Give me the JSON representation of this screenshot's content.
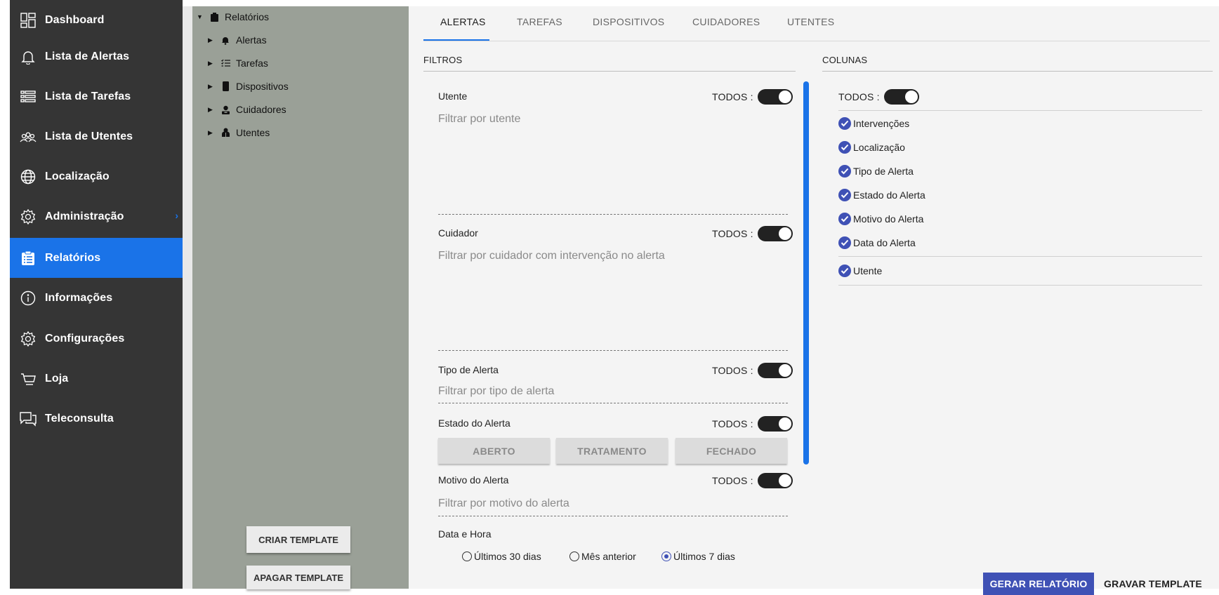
{
  "sidebar": {
    "items": [
      {
        "label": "Dashboard",
        "icon": "dashboard-icon"
      },
      {
        "label": "Lista de Alertas",
        "icon": "bell-icon"
      },
      {
        "label": "Lista de Tarefas",
        "icon": "list-icon"
      },
      {
        "label": "Lista de Utentes",
        "icon": "people-icon"
      },
      {
        "label": "Localização",
        "icon": "globe-icon"
      },
      {
        "label": "Administração",
        "icon": "gear-icon",
        "chevron": "›"
      },
      {
        "label": "Relatórios",
        "icon": "clipboard-icon",
        "active": true
      },
      {
        "label": "Informações",
        "icon": "info-icon"
      },
      {
        "label": "Configurações",
        "icon": "gear-icon"
      },
      {
        "label": "Loja",
        "icon": "cart-icon"
      },
      {
        "label": "Teleconsulta",
        "icon": "chat-icon"
      }
    ]
  },
  "tree": {
    "root": {
      "label": "Relatórios",
      "icon": "clipboard-icon"
    },
    "children": [
      {
        "label": "Alertas",
        "icon": "bell-icon"
      },
      {
        "label": "Tarefas",
        "icon": "checklist-icon"
      },
      {
        "label": "Dispositivos",
        "icon": "phone-icon"
      },
      {
        "label": "Cuidadores",
        "icon": "caregiver-icon"
      },
      {
        "label": "Utentes",
        "icon": "patient-icon"
      }
    ],
    "create_template": "CRIAR TEMPLATE",
    "delete_template": "APAGAR TEMPLATE"
  },
  "tabs": [
    "ALERTAS",
    "TAREFAS",
    "DISPOSITIVOS",
    "CUIDADORES",
    "UTENTES"
  ],
  "filters": {
    "title": "FILTROS",
    "todos_label": "TODOS :",
    "utente": {
      "label": "Utente",
      "placeholder": "Filtrar por utente"
    },
    "cuidador": {
      "label": "Cuidador",
      "placeholder": "Filtrar por cuidador com intervenção no alerta"
    },
    "tipo": {
      "label": "Tipo de Alerta",
      "placeholder": "Filtrar por tipo de alerta"
    },
    "estado": {
      "label": "Estado do Alerta",
      "buttons": [
        "ABERTO",
        "TRATAMENTO",
        "FECHADO"
      ]
    },
    "motivo": {
      "label": "Motivo do Alerta",
      "placeholder": "Filtrar por motivo do alerta"
    },
    "data": {
      "label": "Data e Hora",
      "options": [
        "Últimos 30 dias",
        "Mês anterior",
        "Últimos 7 dias"
      ],
      "selected": "Últimos 7 dias"
    }
  },
  "columns": {
    "title": "COLUNAS",
    "todos_label": "TODOS :",
    "items": [
      "Intervenções",
      "Localização",
      "Tipo de Alerta",
      "Estado do Alerta",
      "Motivo do Alerta",
      "Data do Alerta"
    ],
    "extra": "Utente"
  },
  "actions": {
    "generate": "GERAR RELATÓRIO",
    "save_template": "GRAVAR TEMPLATE"
  },
  "colors": {
    "accent": "#1a73e8",
    "check": "#3f51b5",
    "sidebar_bg": "#353535",
    "tree_bg": "#9aa097"
  }
}
